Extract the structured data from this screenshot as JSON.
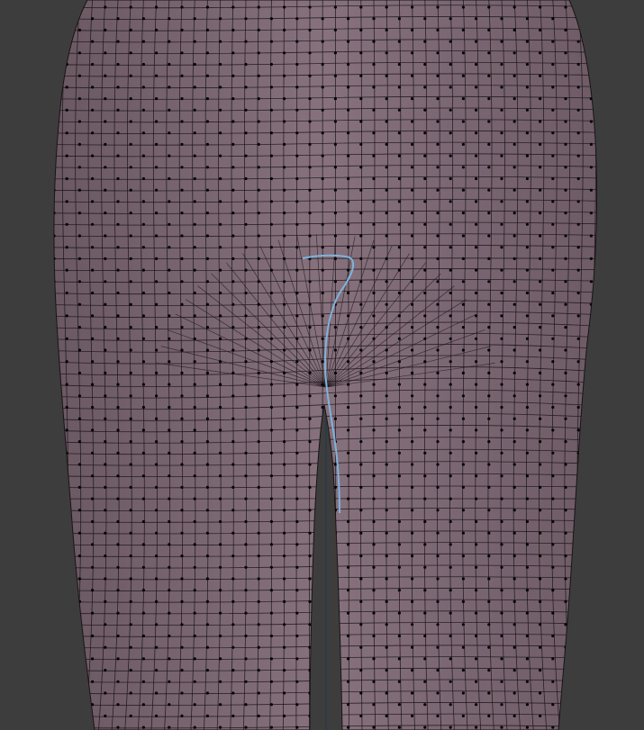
{
  "viewport": {
    "background_color": "#3d3d3d",
    "mesh_fill_color": "#7e6a75",
    "mesh_shade_color": "#6c5a64",
    "wire_color": "#1a1416",
    "vertex_color": "#050405",
    "selected_edge_color": "#7fb3dc",
    "axis_line_color": "#2f3a44"
  }
}
